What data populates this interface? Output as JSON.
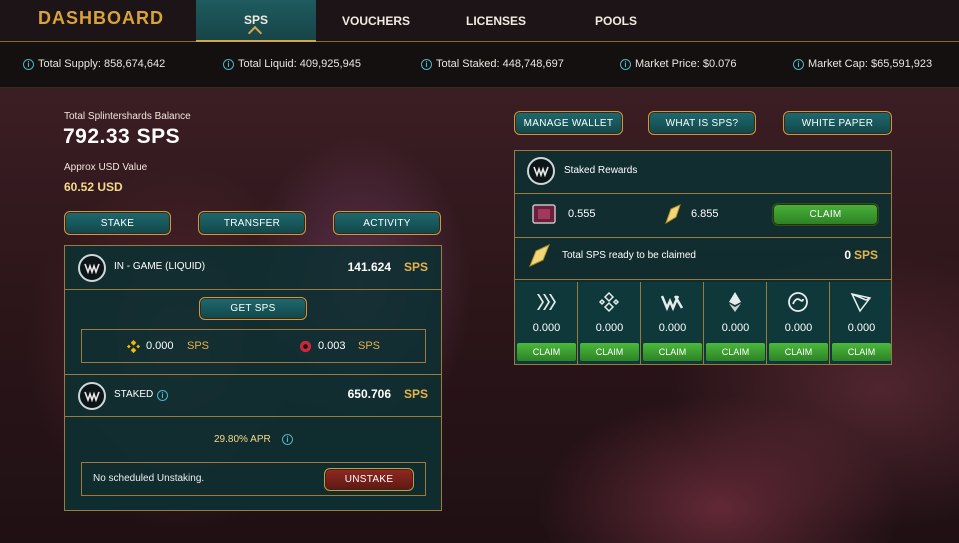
{
  "nav": {
    "brand": "DASHBOARD",
    "tabs": [
      {
        "label": "SPS",
        "active": true
      },
      {
        "label": "VOUCHERS",
        "active": false
      },
      {
        "label": "LICENSES",
        "active": false
      },
      {
        "label": "POOLS",
        "active": false
      }
    ]
  },
  "stats": {
    "total_supply": "Total Supply: 858,674,642",
    "total_liquid": "Total Liquid: 409,925,945",
    "total_staked": "Total Staked: 448,748,697",
    "market_price": "Market Price: $0.076",
    "market_cap": "Market Cap: $65,591,923"
  },
  "balance": {
    "label": "Total Splintershards Balance",
    "value": "792.33 SPS",
    "usd_label": "Approx USD Value",
    "usd_value": "60.52 USD"
  },
  "actions": {
    "stake": "STAKE",
    "transfer": "TRANSFER",
    "activity": "ACTIVITY"
  },
  "in_game": {
    "label": "IN - GAME (LIQUID)",
    "amount": "141.624",
    "unit": "SPS",
    "get_sps": "GET SPS",
    "bsc_amount": "0.000",
    "bsc_unit": "SPS",
    "other_amount": "0.003",
    "other_unit": "SPS"
  },
  "staked": {
    "label": "STAKED",
    "amount": "650.706",
    "unit": "SPS",
    "apr": "29.80% APR",
    "unstaking_text": "No scheduled Unstaking.",
    "unstake": "UNSTAKE"
  },
  "wallet_buttons": {
    "manage": "MANAGE WALLET",
    "what": "WHAT IS SPS?",
    "paper": "WHITE PAPER"
  },
  "rewards": {
    "title": "Staked Rewards",
    "card_amount": "0.555",
    "shard_amount": "6.855",
    "claim": "CLAIM",
    "ready_label": "Total SPS ready to be claimed",
    "ready_amount": "0",
    "ready_unit": "SPS"
  },
  "chains": [
    {
      "icon": "hive-icon",
      "value": "0.000",
      "claim": "CLAIM"
    },
    {
      "icon": "binance-icon",
      "value": "0.000",
      "claim": "CLAIM"
    },
    {
      "icon": "wax-icon",
      "value": "0.000",
      "claim": "CLAIM"
    },
    {
      "icon": "ethereum-icon",
      "value": "0.000",
      "claim": "CLAIM"
    },
    {
      "icon": "steem-icon",
      "value": "0.000",
      "claim": "CLAIM"
    },
    {
      "icon": "tron-icon",
      "value": "0.000",
      "claim": "CLAIM"
    }
  ],
  "colors": {
    "accent_gold": "#d9a33c",
    "panel_teal": "#0c3032",
    "claim_green": "#3fa632",
    "unit_gold": "#e3b24e"
  }
}
